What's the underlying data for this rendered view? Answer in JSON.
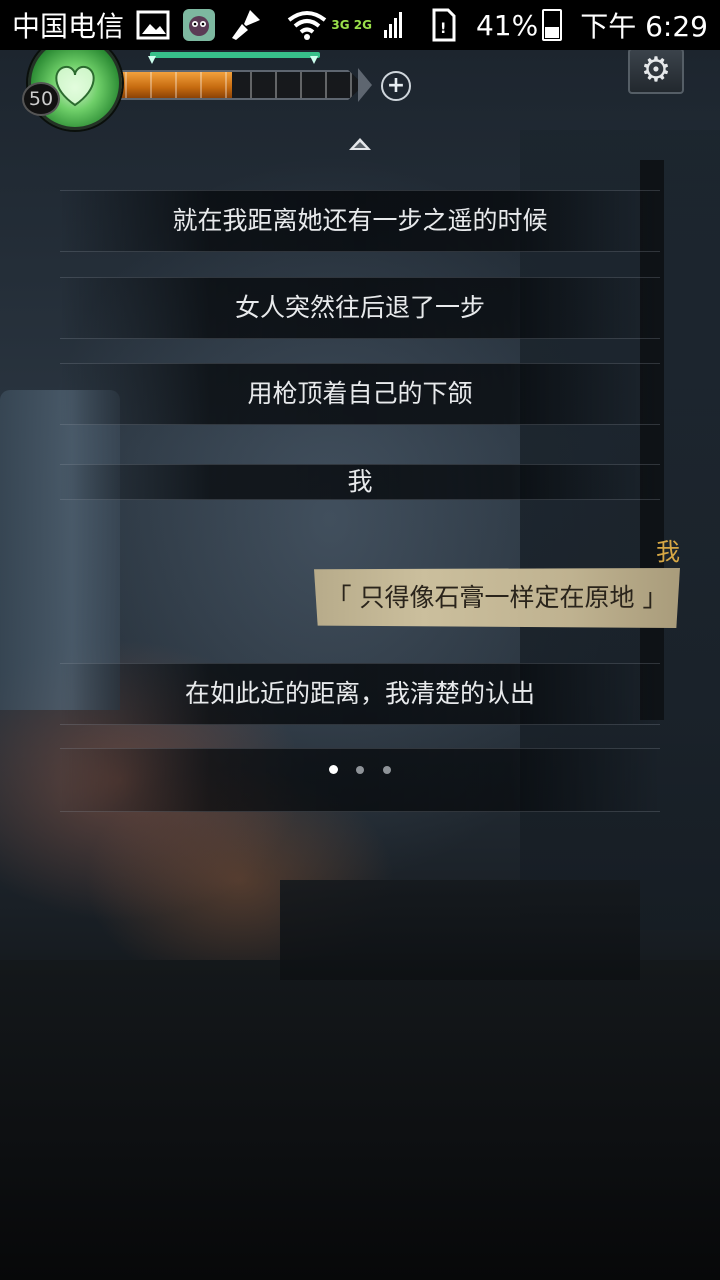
{
  "status_bar": {
    "carrier": "中国电信",
    "network": "3G 2G",
    "battery": "41%",
    "time": "下午 6:29",
    "icons": [
      "gallery-icon",
      "app-monster-icon",
      "cleaner-icon",
      "wifi-icon",
      "signal-icon",
      "sim-icon",
      "battery-icon"
    ]
  },
  "hud": {
    "level": "50",
    "health_fraction": 1.0,
    "exp_fraction": 0.5,
    "add_label": "+",
    "settings_icon": "gear-icon",
    "portrait_icon": "heart-portrait-icon",
    "colors": {
      "health": "#37c08a",
      "exp": "#e07f1a"
    }
  },
  "story": {
    "lines": [
      "就在我距离她还有一步之遥的时候",
      "女人突然往后退了一步",
      "用枪顶着自己的下颌",
      "我"
    ],
    "speaker": "我",
    "speech": "「 只得像石膏一样定在原地 」",
    "after_line": "在如此近的距离，我清楚的认出",
    "speaker_color": "#d7a845"
  },
  "pagination": {
    "total": 3,
    "active": 0
  }
}
